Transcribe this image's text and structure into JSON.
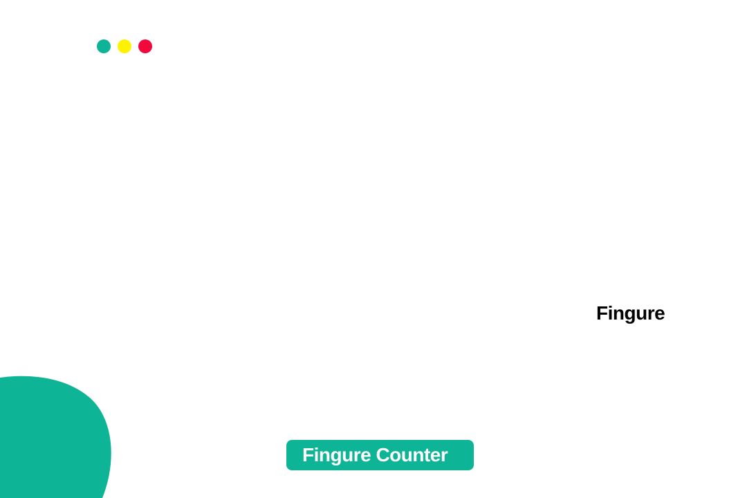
{
  "window_controls": {
    "dots": [
      {
        "name": "green-dot-icon",
        "color": "#0db496"
      },
      {
        "name": "yellow-dot-icon",
        "color": "#fff200"
      },
      {
        "name": "red-dot-icon",
        "color": "#f0093a"
      }
    ]
  },
  "decoration": {
    "blob_color": "#0db496"
  },
  "side_label": "Fingure",
  "counter_button": {
    "label": "Fingure Counter",
    "background": "#0db496"
  }
}
